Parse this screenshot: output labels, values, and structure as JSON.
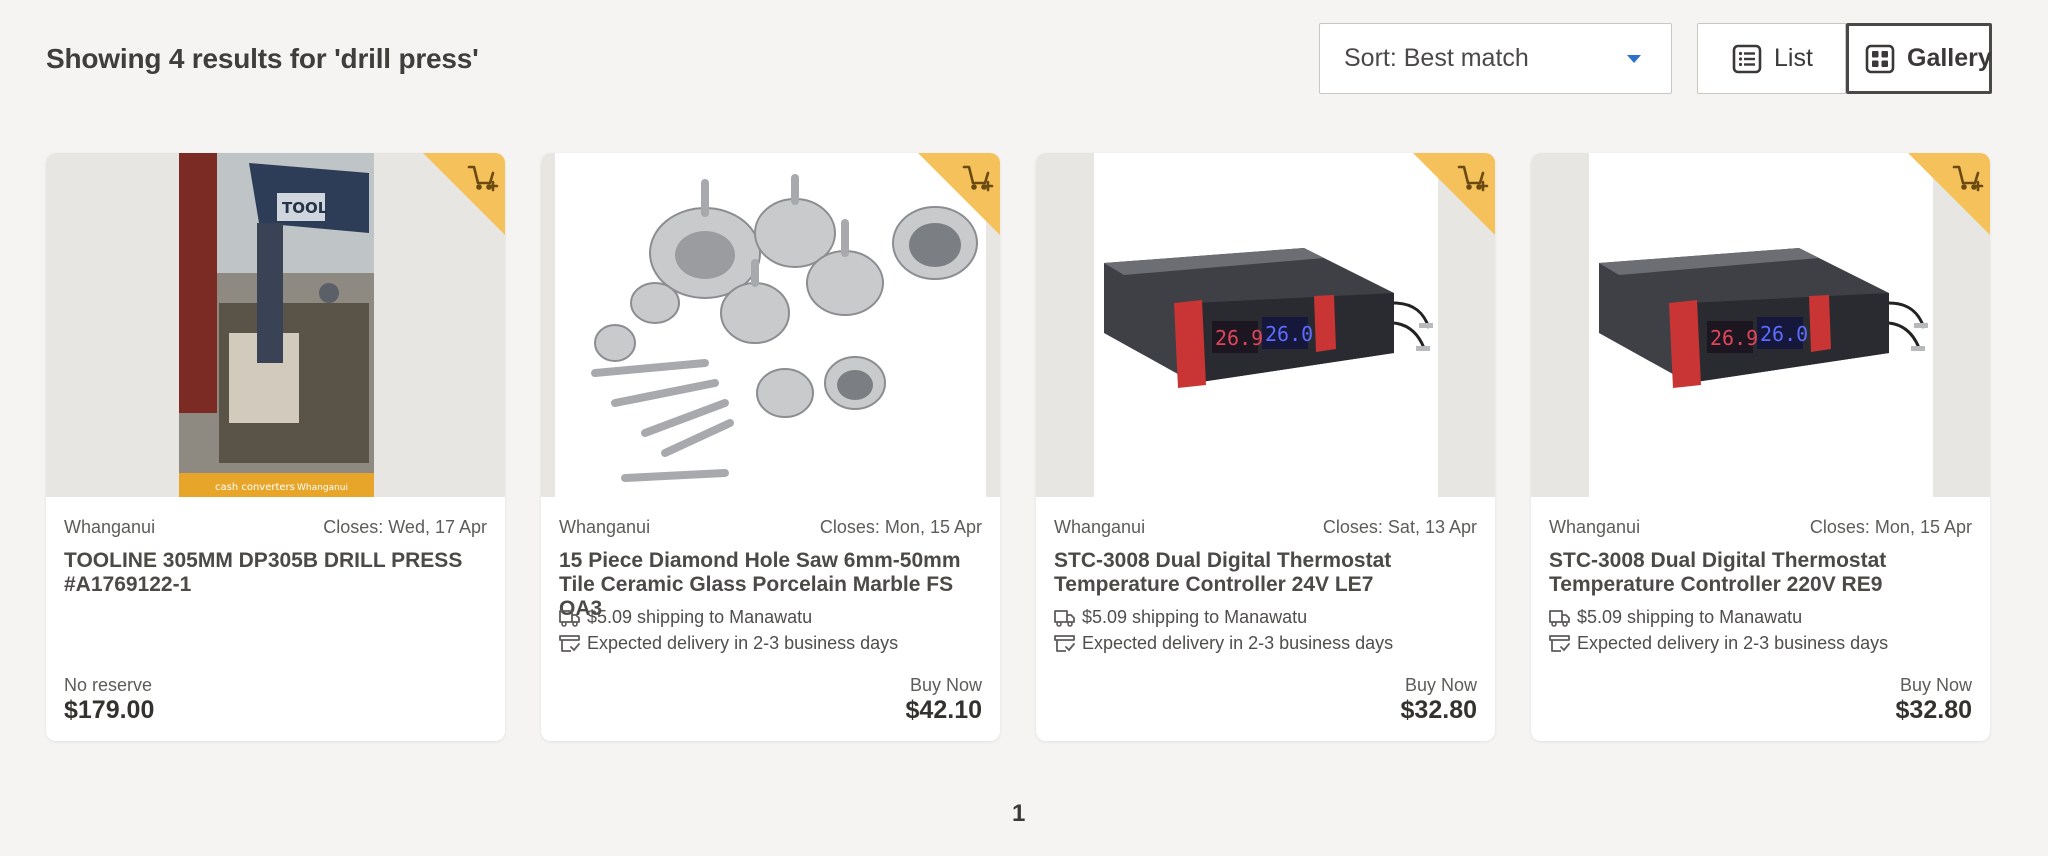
{
  "results_title": "Showing 4 results for 'drill press'",
  "sort": {
    "value": "Sort: Best match"
  },
  "view": {
    "list_label": "List",
    "gallery_label": "Gallery",
    "selected": "Gallery"
  },
  "colors": {
    "accent": "#2b74c8",
    "watch_corner": "#f5c15a",
    "watch_icon": "#6b4a12"
  },
  "listings": [
    {
      "location": "Whanganui",
      "closes": "Closes: Wed, 17 Apr",
      "title": "TOOLINE 305MM DP305B DRILL PRESS #A1769122-1",
      "shipping": "",
      "delivery": "",
      "price_label": "No reserve",
      "price": "$179.00",
      "image": "drill-press-photo"
    },
    {
      "location": "Whanganui",
      "closes": "Closes: Mon, 15 Apr",
      "title": "15 Piece Diamond Hole Saw 6mm-50mm Tile Ceramic Glass Porcelain Marble FS OA3",
      "shipping": "$5.09 shipping to Manawatu",
      "delivery": "Expected delivery in 2-3 business days",
      "price_label": "Buy Now",
      "price": "$42.10",
      "image": "hole-saw-set-photo"
    },
    {
      "location": "Whanganui",
      "closes": "Closes: Sat, 13 Apr",
      "title": "STC-3008 Dual Digital Thermostat Temperature Controller 24V LE7",
      "shipping": "$5.09 shipping to Manawatu",
      "delivery": "Expected delivery in 2-3 business days",
      "price_label": "Buy Now",
      "price": "$32.80",
      "image": "thermostat-controller-photo"
    },
    {
      "location": "Whanganui",
      "closes": "Closes: Mon, 15 Apr",
      "title": "STC-3008 Dual Digital Thermostat Temperature Controller 220V RE9",
      "shipping": "$5.09 shipping to Manawatu",
      "delivery": "Expected delivery in 2-3 business days",
      "price_label": "Buy Now",
      "price": "$32.80",
      "image": "thermostat-controller-photo"
    }
  ],
  "pagination": {
    "current": "1"
  },
  "image_text": {
    "thermo_left": "26.9",
    "thermo_right": "26.0",
    "store_logo": "cash converters",
    "store_branch": "Whanganui",
    "tool_brand": "TOOL"
  }
}
